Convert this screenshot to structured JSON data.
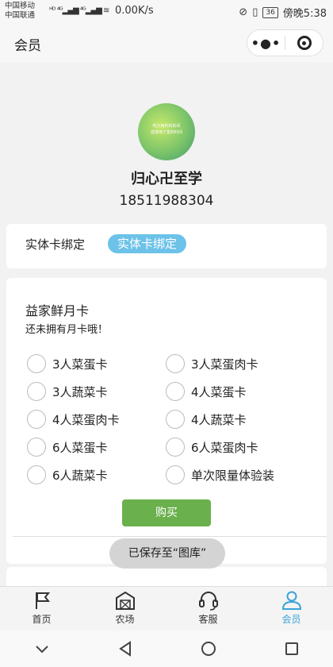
{
  "status_bar": {
    "carrier1": "中国移动",
    "carrier2": "中国联通",
    "signal_text": "HD 4G ⁴ᴳ",
    "net_speed": "0.00K/s",
    "battery": "36",
    "time": "傍晚5:38"
  },
  "nav": {
    "title": "会员",
    "more_icon": "more-dots-icon",
    "close_icon": "target-icon"
  },
  "profile": {
    "avatar_text_line1": "吃只用的的的间",
    "avatar_text_line2": "选择用了更的时间",
    "username": "归心卍至学",
    "phone": "18511988304"
  },
  "card_binding": {
    "label": "实体卡绑定",
    "button_label": "实体卡绑定"
  },
  "monthly_card": {
    "title": "益家鲜月卡",
    "subtitle": "还未拥有月卡哦！",
    "options": [
      "3人菜蛋卡",
      "3人菜蛋肉卡",
      "3人蔬菜卡",
      "4人菜蛋卡",
      "4人菜蛋肉卡",
      "4人蔬菜卡",
      "6人菜蛋卡",
      "6人菜蛋肉卡",
      "6人蔬菜卡",
      "单次限量体验装"
    ],
    "buy_label": "购买"
  },
  "toast": "已保存至“图库”",
  "tabs": [
    {
      "label": "首页",
      "icon": "flag-icon"
    },
    {
      "label": "农场",
      "icon": "barn-icon"
    },
    {
      "label": "客服",
      "icon": "headset-icon"
    },
    {
      "label": "会员",
      "icon": "user-icon",
      "active": true
    }
  ],
  "colors": {
    "accent_blue": "#3aa4d8",
    "tag_blue": "#6cc2e8",
    "buy_green": "#6ab04c"
  }
}
